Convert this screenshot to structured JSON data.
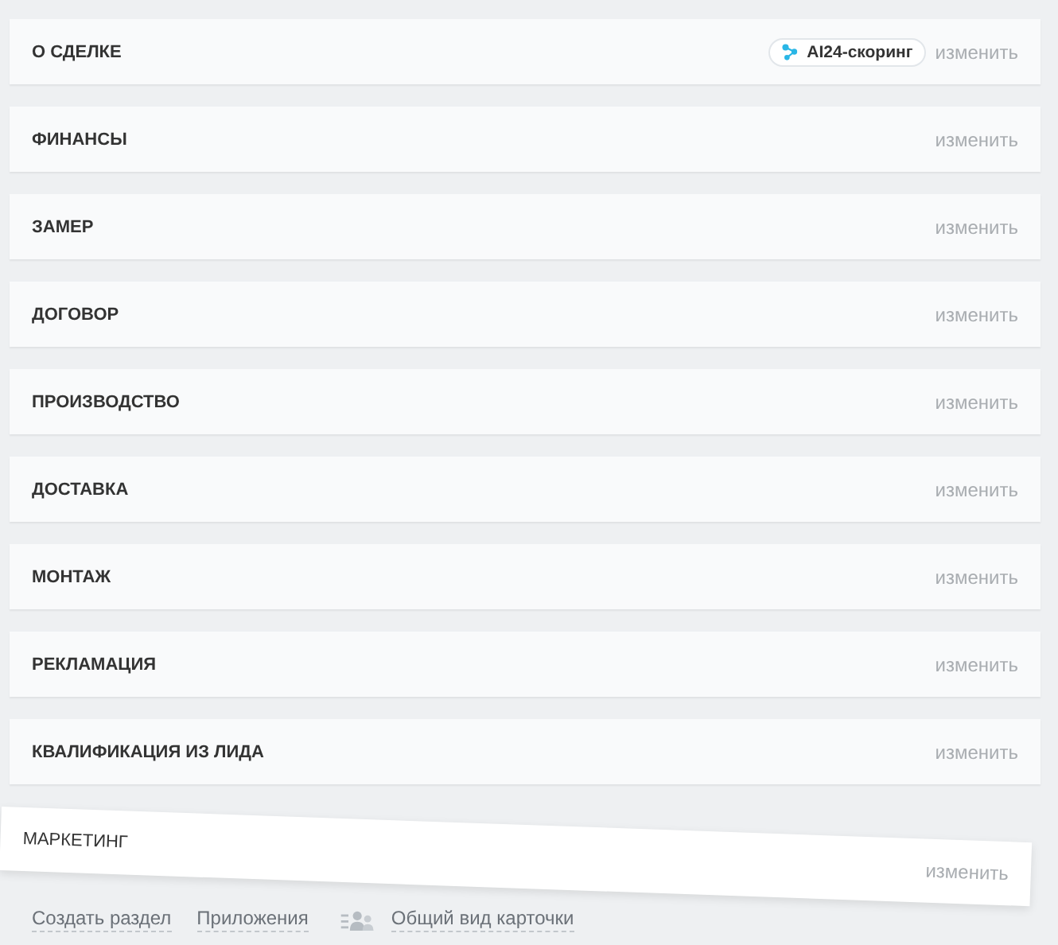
{
  "sections": [
    {
      "title": "О СДЕЛКЕ",
      "badge": "AI24-скоринг",
      "action": "изменить",
      "dragging": false
    },
    {
      "title": "ФИНАНСЫ",
      "action": "изменить",
      "dragging": false
    },
    {
      "title": "ЗАМЕР",
      "action": "изменить",
      "dragging": false
    },
    {
      "title": "ДОГОВОР",
      "action": "изменить",
      "dragging": false
    },
    {
      "title": "ПРОИЗВОДСТВО",
      "action": "изменить",
      "dragging": false
    },
    {
      "title": "ДОСТАВКА",
      "action": "изменить",
      "dragging": false
    },
    {
      "title": "МОНТАЖ",
      "action": "изменить",
      "dragging": false
    },
    {
      "title": "РЕКЛАМАЦИЯ",
      "action": "изменить",
      "dragging": false
    },
    {
      "title": "КВАЛИФИКАЦИЯ ИЗ ЛИДА",
      "action": "изменить",
      "dragging": false
    },
    {
      "title": "МАРКЕТИНГ",
      "action": "изменить",
      "dragging": true
    }
  ],
  "footer": [
    {
      "label": "Создать раздел",
      "kind": "link"
    },
    {
      "label": "Приложения",
      "kind": "link"
    },
    {
      "label": "Общий вид карточки",
      "kind": "icon-link"
    }
  ]
}
